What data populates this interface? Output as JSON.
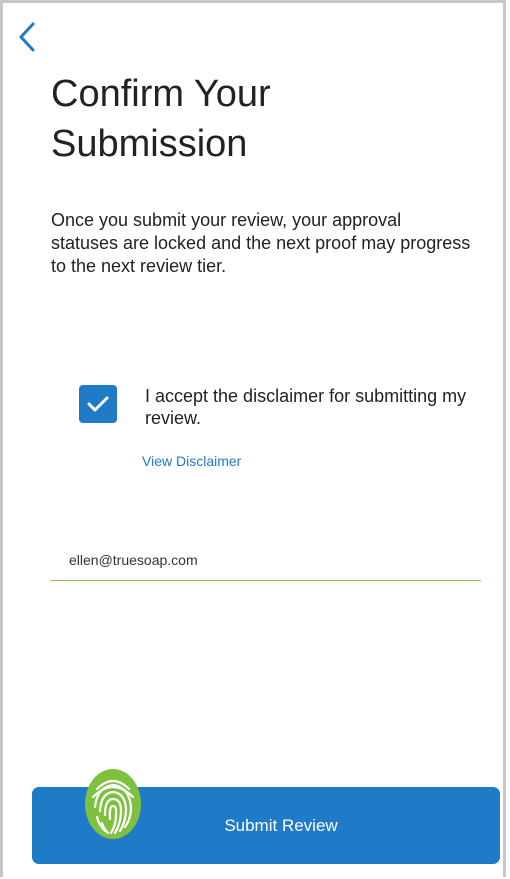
{
  "header": {
    "title": "Confirm Your Submission"
  },
  "body": {
    "description": "Once you submit your review, your approval statuses are locked and the next proof may progress to the next review tier."
  },
  "disclaimer": {
    "checked": true,
    "label": "I accept the disclaimer for submitting my review.",
    "link_label": "View Disclaimer"
  },
  "email": {
    "value": "ellen@truesoap.com"
  },
  "submit": {
    "label": "Submit Review"
  },
  "icons": {
    "back": "chevron-left-icon",
    "checkbox": "checkmark-icon",
    "biometric": "fingerprint-icon"
  },
  "colors": {
    "accent": "#1f7ac8",
    "field_underline": "#8cc63f",
    "fingerprint": "#7ec13f"
  }
}
